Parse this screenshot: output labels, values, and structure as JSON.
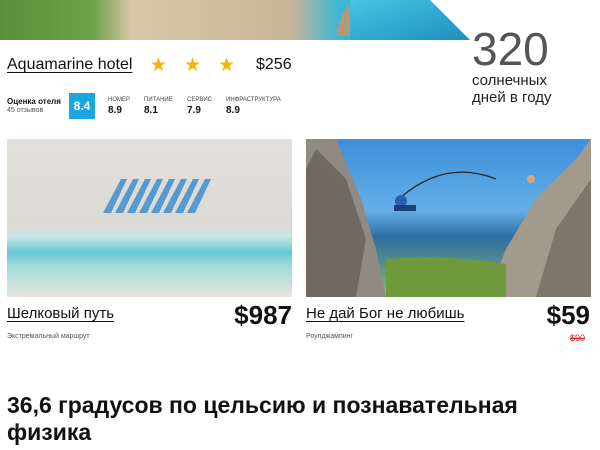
{
  "hotel": {
    "name": "Aquamarine hotel",
    "stars": 3,
    "price": "$256",
    "rating_label": "Оценка отеля",
    "reviews": "45 отзывов",
    "score": "8.4",
    "subscores": [
      {
        "label": "НОМЕР",
        "value": "8.9"
      },
      {
        "label": "ПИТАНИЕ",
        "value": "8.1"
      },
      {
        "label": "СЕРВИС",
        "value": "7.9"
      },
      {
        "label": "ИНФРАСТРУКТУРА",
        "value": "8.9"
      }
    ]
  },
  "sunny": {
    "number": "320",
    "line1": "солнечных",
    "line2": "дней в году"
  },
  "cards": [
    {
      "title": "Шелковый путь",
      "price": "$987",
      "subtitle": "Экстремальный маршрут",
      "old_price": ""
    },
    {
      "title": "Не дай Бог не любишь",
      "price": "$59",
      "subtitle": "Роупджампинг",
      "old_price": "$90"
    }
  ],
  "headline": "36,6 градусов по цельсию и познавательная физика",
  "colors": {
    "accent": "#1aa7e0",
    "star": "#f2b705",
    "old_price": "#e02020"
  }
}
